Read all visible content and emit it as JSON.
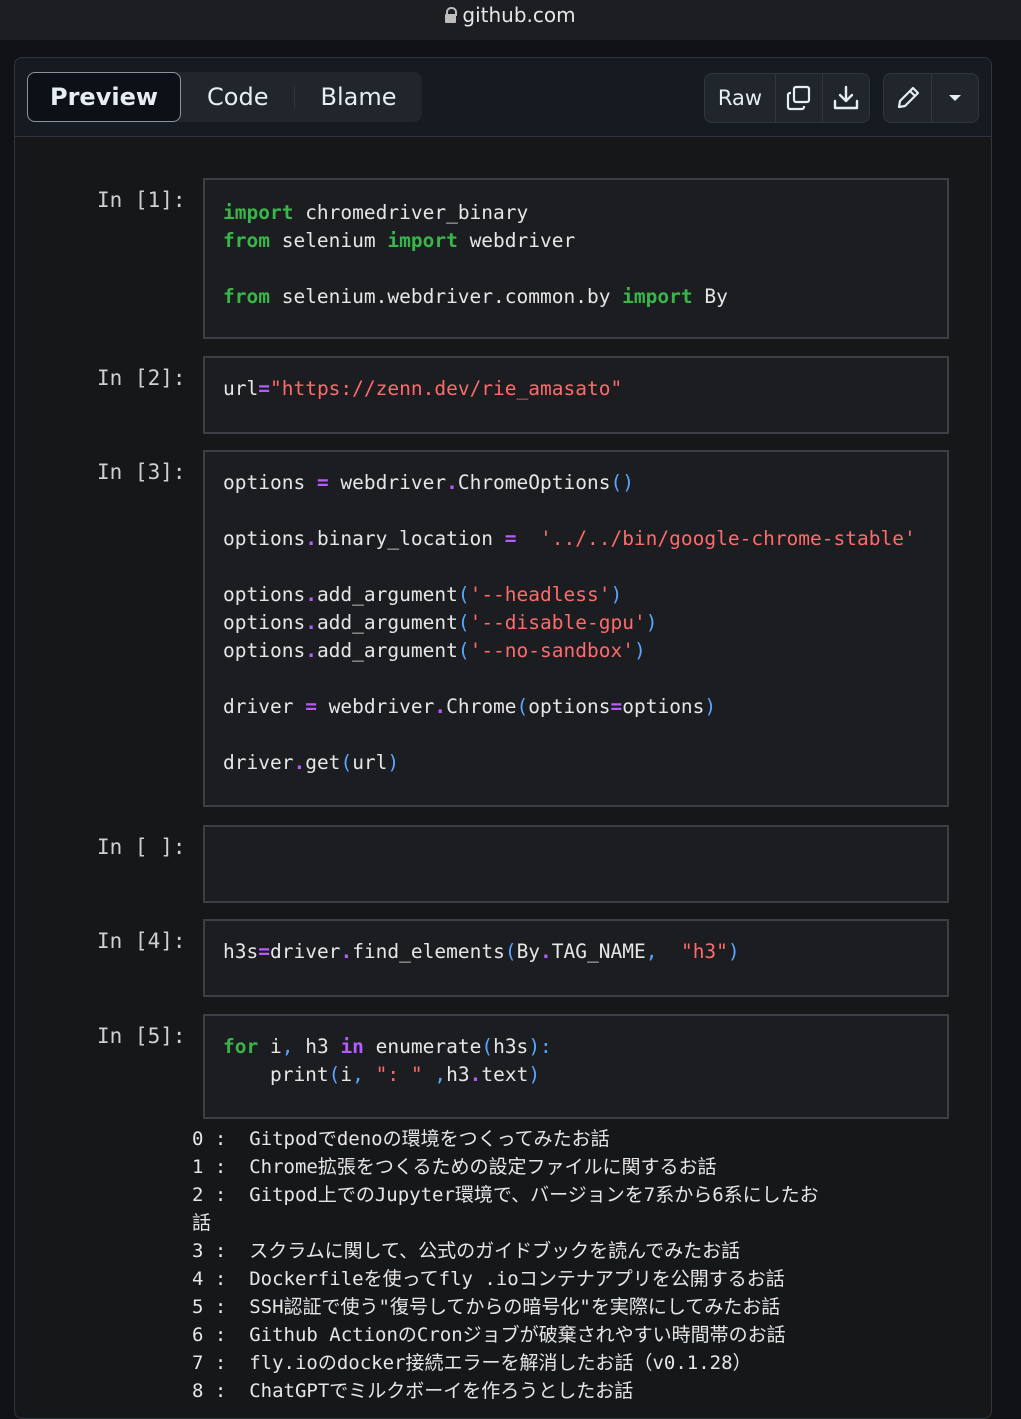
{
  "browser": {
    "url": "github.com"
  },
  "toolbar": {
    "tabs": [
      {
        "label": "Preview"
      },
      {
        "label": "Code"
      },
      {
        "label": "Blame"
      }
    ],
    "raw_label": "Raw",
    "icons": [
      "copy-icon",
      "download-icon",
      "pencil-icon",
      "triangle-down-icon"
    ]
  },
  "notebook": {
    "cells": [
      {
        "prompt": "In [1]:",
        "lines": [
          [
            {
              "t": "import",
              "c": "kw"
            },
            {
              "t": " chromedriver_binary"
            }
          ],
          [
            {
              "t": "from",
              "c": "kw"
            },
            {
              "t": " selenium "
            },
            {
              "t": "import",
              "c": "kw"
            },
            {
              "t": " webdriver"
            }
          ],
          [],
          [
            {
              "t": "from",
              "c": "kw"
            },
            {
              "t": " selenium.webdriver.common.by "
            },
            {
              "t": "import",
              "c": "kw"
            },
            {
              "t": " By"
            }
          ]
        ]
      },
      {
        "prompt": "In [2]:",
        "lines": [
          [
            {
              "t": "url"
            },
            {
              "t": "=",
              "c": "op"
            },
            {
              "t": "\"https://zenn.dev/rie_amasato\"",
              "c": "str"
            }
          ]
        ]
      },
      {
        "prompt": "In [3]:",
        "lines": [
          [
            {
              "t": "options "
            },
            {
              "t": "=",
              "c": "op"
            },
            {
              "t": " webdriver"
            },
            {
              "t": ".",
              "c": "op"
            },
            {
              "t": "ChromeOptions"
            },
            {
              "t": "()",
              "c": "pn"
            }
          ],
          [],
          [
            {
              "t": "options"
            },
            {
              "t": ".",
              "c": "op"
            },
            {
              "t": "binary_location "
            },
            {
              "t": "=",
              "c": "op"
            },
            {
              "t": "  "
            },
            {
              "t": "'../../bin/google-chrome-stable'",
              "c": "str"
            }
          ],
          [],
          [
            {
              "t": "options"
            },
            {
              "t": ".",
              "c": "op"
            },
            {
              "t": "add_argument"
            },
            {
              "t": "(",
              "c": "pn"
            },
            {
              "t": "'--headless'",
              "c": "str"
            },
            {
              "t": ")",
              "c": "pn"
            }
          ],
          [
            {
              "t": "options"
            },
            {
              "t": ".",
              "c": "op"
            },
            {
              "t": "add_argument"
            },
            {
              "t": "(",
              "c": "pn"
            },
            {
              "t": "'--disable-gpu'",
              "c": "str"
            },
            {
              "t": ")",
              "c": "pn"
            }
          ],
          [
            {
              "t": "options"
            },
            {
              "t": ".",
              "c": "op"
            },
            {
              "t": "add_argument"
            },
            {
              "t": "(",
              "c": "pn"
            },
            {
              "t": "'--no-sandbox'",
              "c": "str"
            },
            {
              "t": ")",
              "c": "pn"
            }
          ],
          [],
          [
            {
              "t": "driver "
            },
            {
              "t": "=",
              "c": "op"
            },
            {
              "t": " webdriver"
            },
            {
              "t": ".",
              "c": "op"
            },
            {
              "t": "Chrome"
            },
            {
              "t": "(",
              "c": "pn"
            },
            {
              "t": "options"
            },
            {
              "t": "=",
              "c": "op"
            },
            {
              "t": "options"
            },
            {
              "t": ")",
              "c": "pn"
            }
          ],
          [],
          [
            {
              "t": "driver"
            },
            {
              "t": ".",
              "c": "op"
            },
            {
              "t": "get"
            },
            {
              "t": "(",
              "c": "pn"
            },
            {
              "t": "url"
            },
            {
              "t": ")",
              "c": "pn"
            }
          ]
        ]
      },
      {
        "prompt": "In [ ]:",
        "lines": []
      },
      {
        "prompt": "In [4]:",
        "lines": [
          [
            {
              "t": "h3s"
            },
            {
              "t": "=",
              "c": "op"
            },
            {
              "t": "driver"
            },
            {
              "t": ".",
              "c": "op"
            },
            {
              "t": "find_elements"
            },
            {
              "t": "(",
              "c": "pn"
            },
            {
              "t": "By"
            },
            {
              "t": ".",
              "c": "op"
            },
            {
              "t": "TAG_NAME"
            },
            {
              "t": ", ",
              "c": "pn"
            },
            {
              "t": " "
            },
            {
              "t": "\"h3\"",
              "c": "str"
            },
            {
              "t": ")",
              "c": "pn"
            }
          ]
        ]
      },
      {
        "prompt": "In [5]:",
        "lines": [
          [
            {
              "t": "for",
              "c": "kw"
            },
            {
              "t": " i"
            },
            {
              "t": ",",
              "c": "pn"
            },
            {
              "t": " h3 "
            },
            {
              "t": "in",
              "c": "op"
            },
            {
              "t": " enumerate"
            },
            {
              "t": "(",
              "c": "pn"
            },
            {
              "t": "h3s"
            },
            {
              "t": "):",
              "c": "pn"
            }
          ],
          [
            {
              "t": "    print"
            },
            {
              "t": "(",
              "c": "pn"
            },
            {
              "t": "i"
            },
            {
              "t": ",",
              "c": "pn"
            },
            {
              "t": " "
            },
            {
              "t": "\": \"",
              "c": "str"
            },
            {
              "t": " "
            },
            {
              "t": ",",
              "c": "pn"
            },
            {
              "t": "h3"
            },
            {
              "t": ".",
              "c": "op"
            },
            {
              "t": "text"
            },
            {
              "t": ")",
              "c": "pn"
            }
          ]
        ]
      }
    ],
    "output": [
      "0 :  Gitpodでdenoの環境をつくってみたお話",
      "1 :  Chrome拡張をつくるための設定ファイルに関するお話",
      "2 :  Gitpod上でのJupyter環境で、バージョンを7系から6系にしたお",
      "話",
      "3 :  スクラムに関して、公式のガイドブックを読んでみたお話",
      "4 :  Dockerfileを使ってfly .ioコンテナアプリを公開するお話",
      "5 :  SSH認証で使う\"復号してからの暗号化\"を実際にしてみたお話",
      "6 :  Github ActionのCronジョブが破棄されやすい時間帯のお話",
      "7 :  fly.ioのdocker接続エラーを解消したお話（v0.1.28）",
      "8 :  ChatGPTでミルクボーイを作ろうとしたお話"
    ]
  }
}
